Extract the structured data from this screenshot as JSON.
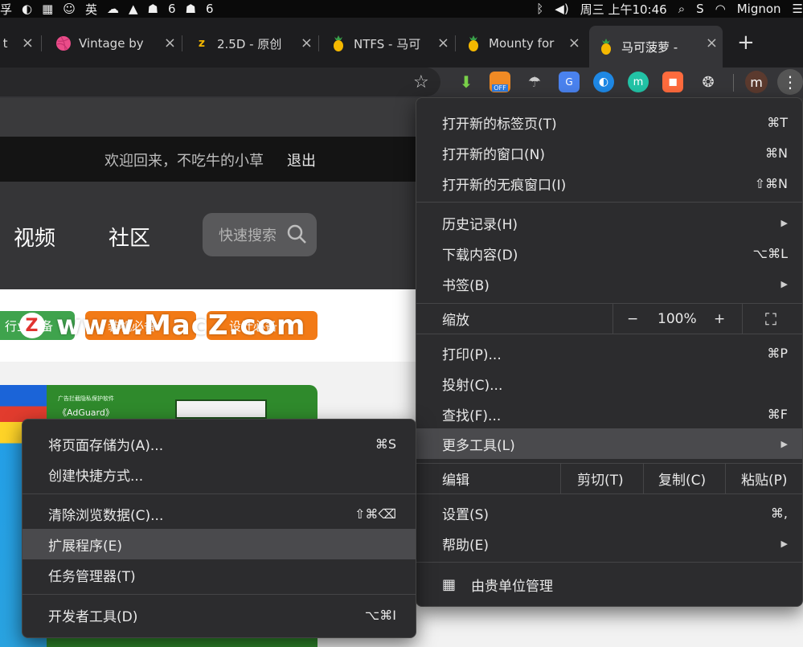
{
  "menubar": {
    "left_items": [
      "孚",
      "◐",
      "▦",
      "☺",
      "英",
      "☁",
      "▲",
      "☗",
      "6",
      "☗",
      "6"
    ],
    "date_time": "周三 上午10:46",
    "user": "Mignon"
  },
  "tabs": [
    {
      "label": "y t",
      "favicon": "none"
    },
    {
      "label": "Vintage by",
      "favicon": "dribbble-icon"
    },
    {
      "label": "2.5D - 原创",
      "favicon": "z-icon"
    },
    {
      "label": "NTFS - 马可",
      "favicon": "pineapple-icon"
    },
    {
      "label": "Mounty for",
      "favicon": "pineapple-icon"
    },
    {
      "label": "马可菠萝 -",
      "favicon": "pineapple-icon"
    }
  ],
  "toolbar": {
    "off_badge": "OFF",
    "avatar_letter": "m"
  },
  "page": {
    "welcome": "欢迎回来，不吃牛的小草",
    "logout": "退出",
    "nav_video": "视频",
    "nav_community": "社区",
    "search_placeholder": "快速搜索",
    "green_button": "行业必备",
    "orange_button_1": "装机必备",
    "orange_button_2": "设计必备",
    "watermark": "www.MacZ.com",
    "watermark_logo": "Z",
    "thumb_caption_small": "广告拦截隐私保护软件",
    "thumb_caption": "《AdGuard》"
  },
  "main_menu": {
    "new_tab": "打开新的标签页(T)",
    "new_tab_sc": "⌘T",
    "new_window": "打开新的窗口(N)",
    "new_window_sc": "⌘N",
    "incognito": "打开新的无痕窗口(I)",
    "incognito_sc": "⇧⌘N",
    "history": "历史记录(H)",
    "downloads": "下载内容(D)",
    "downloads_sc": "⌥⌘L",
    "bookmarks": "书签(B)",
    "zoom": "缩放",
    "zoom_minus": "−",
    "zoom_value": "100%",
    "zoom_plus": "+",
    "print": "打印(P)...",
    "print_sc": "⌘P",
    "cast": "投射(C)...",
    "find": "查找(F)...",
    "find_sc": "⌘F",
    "more_tools": "更多工具(L)",
    "edit": "编辑",
    "cut": "剪切(T)",
    "copy": "复制(C)",
    "paste": "粘贴(P)",
    "settings": "设置(S)",
    "settings_sc": "⌘,",
    "help": "帮助(E)",
    "managed": "由贵单位管理"
  },
  "sub_menu": {
    "save_page": "将页面存储为(A)...",
    "save_page_sc": "⌘S",
    "create_shortcut": "创建快捷方式...",
    "clear_data": "清除浏览数据(C)...",
    "clear_data_sc": "⇧⌘⌫",
    "extensions": "扩展程序(E)",
    "task_manager": "任务管理器(T)",
    "dev_tools": "开发者工具(D)",
    "dev_tools_sc": "⌥⌘I"
  },
  "colors": {
    "accent_green": "#3fa34d",
    "accent_orange": "#f27a16",
    "menu_bg": "#2c2c2e",
    "highlight": "#4a4a4d"
  }
}
